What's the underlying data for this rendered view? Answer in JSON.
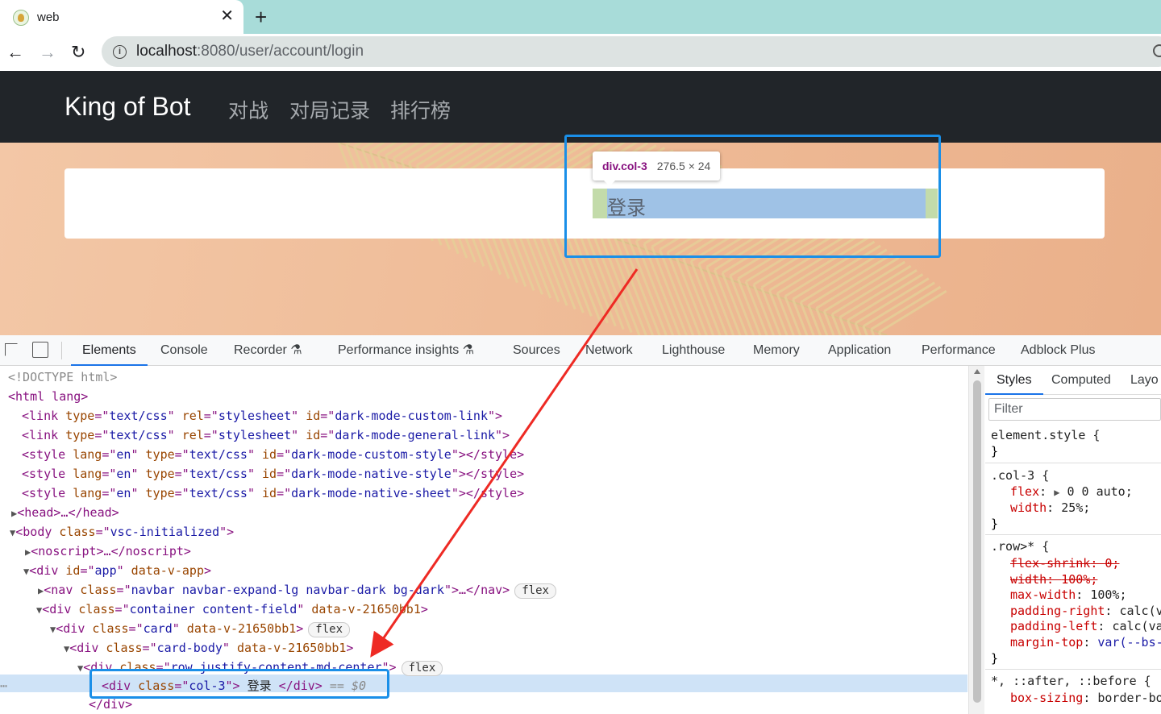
{
  "browser": {
    "tab_title": "web",
    "url_host": "localhost",
    "url_path": ":8080/user/account/login",
    "close_glyph": "✕",
    "new_tab_glyph": "+",
    "back_glyph": "←",
    "forward_glyph": "→",
    "reload_glyph": "↻",
    "info_glyph": "i"
  },
  "site": {
    "brand": "King of Bot",
    "nav": [
      "对战",
      "对局记录",
      "排行榜"
    ],
    "card_text": "登录"
  },
  "inspector_tooltip": {
    "tag": "div.col-3",
    "size": "276.5 × 24"
  },
  "devtools": {
    "tabs": [
      "Elements",
      "Console",
      "Recorder ⚗",
      "Performance insights ⚗",
      "Sources",
      "Network",
      "Lighthouse",
      "Memory",
      "Application",
      "Performance",
      "Adblock Plus"
    ],
    "active_tab": "Elements",
    "side_tabs": [
      "Styles",
      "Computed",
      "Layo"
    ],
    "filter_placeholder": "Filter",
    "dom": {
      "doctype": "<!DOCTYPE html>",
      "html_open": "<html lang>",
      "link1": [
        "<link ",
        "type",
        "=\"",
        "text/css",
        "\" ",
        "rel",
        "=\"",
        "stylesheet",
        "\" ",
        "id",
        "=\"",
        "dark-mode-custom-link",
        "\">"
      ],
      "link2": [
        "<link ",
        "type",
        "=\"",
        "text/css",
        "\" ",
        "rel",
        "=\"",
        "stylesheet",
        "\" ",
        "id",
        "=\"",
        "dark-mode-general-link",
        "\">"
      ],
      "style1": "dark-mode-custom-style",
      "style2": "dark-mode-native-style",
      "style3": "dark-mode-native-sheet",
      "head": "<head>…</head>",
      "body_class": "vsc-initialized",
      "noscript": "<noscript>…</noscript>",
      "app_id": "app",
      "app_attr": "data-v-app",
      "nav_class": "navbar navbar-expand-lg navbar-dark bg-dark",
      "nav_tail": "…</nav>",
      "container_class": "container content-field",
      "scope_attr": "data-v-21650bb1",
      "card_class": "card",
      "card_body_class": "card-body",
      "row_class": "row justify-content-md-center",
      "col_class": "col-3",
      "col_text": " 登录 ",
      "selected_marker": "== $0",
      "flex_badge": "flex",
      "div_close": "</div>"
    },
    "styles": {
      "element_style": "element.style {",
      "close_brace": "}",
      "col3_selector": ".col-3 {",
      "col3_flex_prop": "flex",
      "col3_flex_val": "0 0 auto;",
      "col3_width_prop": "width",
      "col3_width_val": "25%;",
      "row_selector": ".row>* {",
      "row_shrink_prop": "flex-shrink",
      "row_shrink_val": "0;",
      "row_width_prop": "width",
      "row_width_val": "100%;",
      "row_maxw_prop": "max-width",
      "row_maxw_val": "100%;",
      "row_pr_prop": "padding-right",
      "row_pr_val": "calc(v",
      "row_pl_prop": "padding-left",
      "row_pl_val": "calc(va",
      "row_mt_prop": "margin-top",
      "row_mt_val": "var(--bs-",
      "universal_selector": "*, ::after, ::before {",
      "bs_prop": "box-sizing",
      "bs_val": "border-bo"
    }
  },
  "colors": {
    "navbar_bg": "#212529",
    "annotation_blue": "#1a8fe8",
    "annotation_red": "#ee2a24",
    "tab_strip": "#a8dcd9"
  }
}
